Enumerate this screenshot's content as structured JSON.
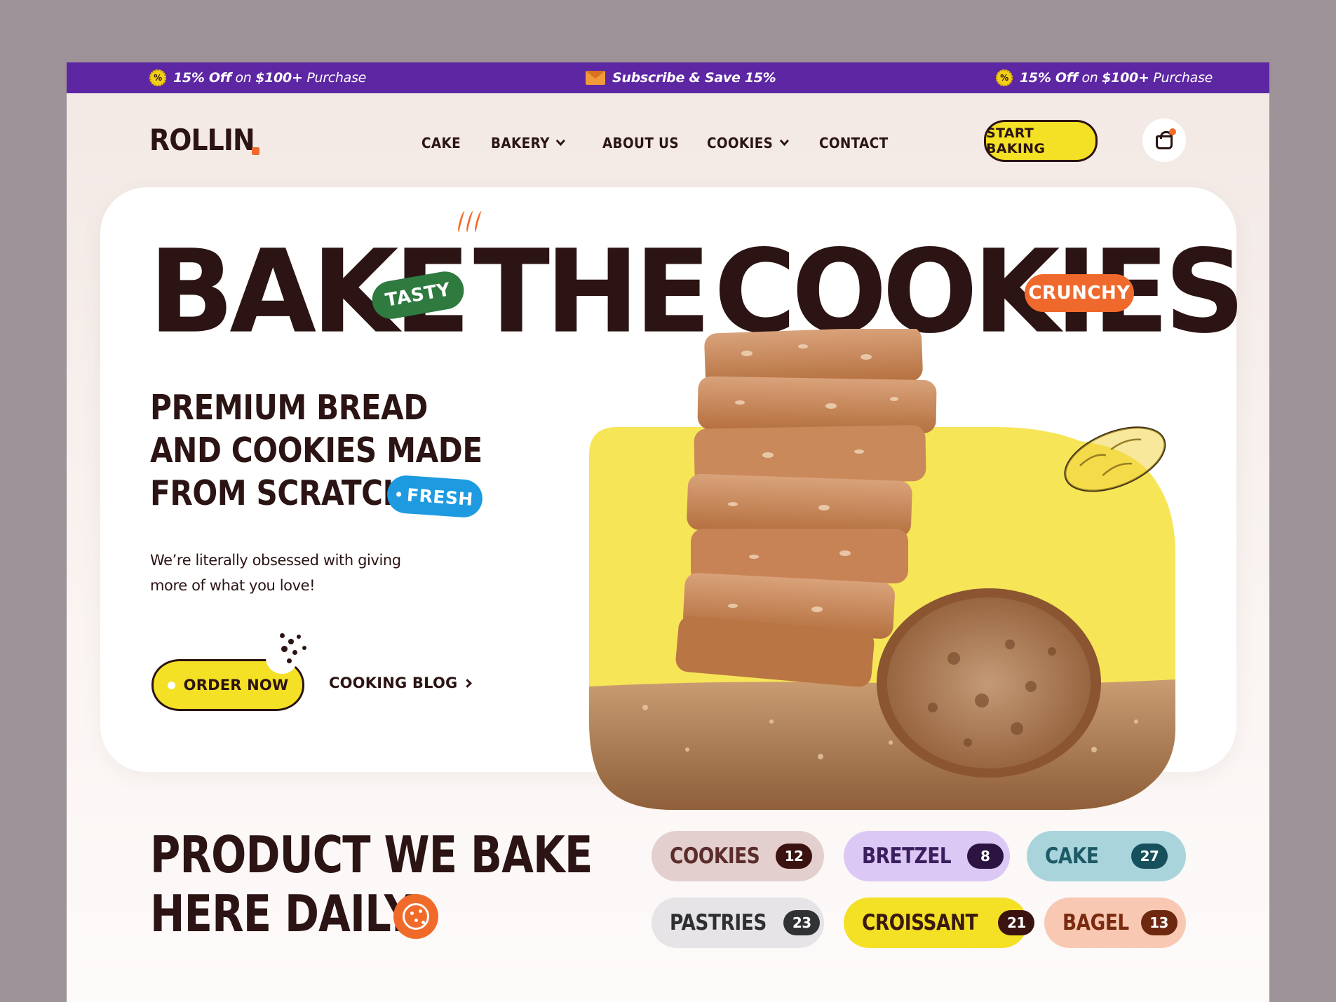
{
  "promo": {
    "left": {
      "bold": "15% Off",
      "on": "on",
      "amount": "$100+",
      "tail": "Purchase",
      "icon": "percent-badge-icon"
    },
    "center": {
      "text": "Subscribe & Save 15%",
      "icon": "envelope-icon"
    },
    "right": {
      "bold": "15% Off",
      "on": "on",
      "amount": "$100+",
      "tail": "Purchase",
      "icon": "percent-badge-icon"
    },
    "percent_glyph": "%"
  },
  "header": {
    "logo": "ROLLIN",
    "nav": [
      {
        "label": "CAKE",
        "dropdown": false
      },
      {
        "label": "BAKERY",
        "dropdown": true
      },
      {
        "label": "ABOUT US",
        "dropdown": false
      },
      {
        "label": "COOKIES",
        "dropdown": true
      },
      {
        "label": "CONTACT",
        "dropdown": false
      }
    ],
    "cta": "START BAKING",
    "cart_icon": "shopping-bag-icon"
  },
  "hero": {
    "title_words": [
      "BAKE",
      "THE",
      "COOKIES"
    ],
    "tags": {
      "tasty": "TASTY",
      "crunchy": "CRUNCHY",
      "fresh": "FRESH"
    },
    "subtitle_lines": [
      "PREMIUM BREAD",
      "AND COOKIES MADE",
      "FROM SCRATCH"
    ],
    "description_lines": [
      "We’re literally obsessed with giving",
      "more of what you love!"
    ],
    "order_button": "ORDER NOW",
    "blog_link": "COOKING BLOG"
  },
  "products": {
    "title_lines": [
      "PRODUCT WE BAKE",
      "HERE DAILY"
    ],
    "categories": [
      {
        "name": "COOKIES",
        "count": "12",
        "bg": "#e4cfcf",
        "fg": "#5a2d2b",
        "badge": "#3a1210"
      },
      {
        "name": "BRETZEL",
        "count": "8",
        "bg": "#dcc8f4",
        "fg": "#3a1f5e",
        "badge": "#2b1440"
      },
      {
        "name": "CAKE",
        "count": "27",
        "bg": "#a9d4dc",
        "fg": "#1d5a66",
        "badge": "#15505c"
      },
      {
        "name": "PASTRIES",
        "count": "23",
        "bg": "#e6e4e6",
        "fg": "#2f2f34",
        "badge": "#303236"
      },
      {
        "name": "CROISSANT",
        "count": "21",
        "bg": "#f4e025",
        "fg": "#3a1a10",
        "badge": "#3a1210"
      },
      {
        "name": "BAGEL",
        "count": "13",
        "bg": "#f8c8b2",
        "fg": "#7a2a10",
        "badge": "#6e2810"
      }
    ]
  }
}
